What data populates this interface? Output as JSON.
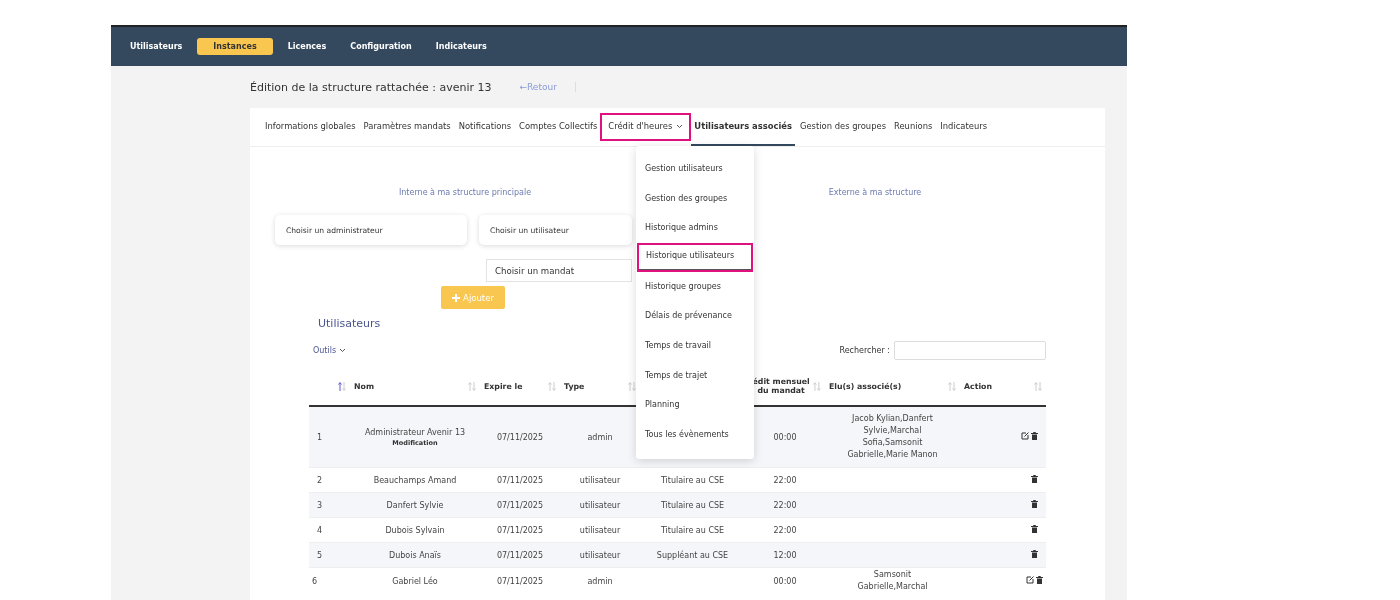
{
  "top_nav": [
    {
      "label": "Utilisateurs",
      "selected": false
    },
    {
      "label": "Instances",
      "selected": true
    },
    {
      "label": "Licences",
      "selected": false
    },
    {
      "label": "Configuration",
      "selected": false
    },
    {
      "label": "Indicateurs",
      "selected": false
    }
  ],
  "heading": "Édition de la structure rattachée : avenir 13",
  "back_link": "←Retour",
  "tabs": [
    {
      "label": "Informations globales",
      "selected": false,
      "highlighted": false
    },
    {
      "label": "Paramètres mandats",
      "selected": false,
      "highlighted": false
    },
    {
      "label": "Notifications",
      "selected": false,
      "highlighted": false
    },
    {
      "label": "Comptes Collectifs",
      "selected": false,
      "highlighted": false
    },
    {
      "label": "Crédit d'heures",
      "selected": false,
      "highlighted": true,
      "dropdown": true
    },
    {
      "label": "Utilisateurs associés",
      "selected": true,
      "highlighted": false
    },
    {
      "label": "Gestion des groupes",
      "selected": false,
      "highlighted": false
    },
    {
      "label": "Reunions",
      "selected": false,
      "highlighted": false
    },
    {
      "label": "Indicateurs",
      "selected": false,
      "highlighted": false
    }
  ],
  "dropdown_menu": [
    {
      "label": "Gestion utilisateurs",
      "highlighted": false
    },
    {
      "label": "Gestion des groupes",
      "highlighted": false
    },
    {
      "label": "Historique admins",
      "highlighted": false
    },
    {
      "label": "Historique utilisateurs",
      "highlighted": true
    },
    {
      "label": "Historique groupes",
      "highlighted": false
    },
    {
      "label": "Délais de prévenance",
      "highlighted": false
    },
    {
      "label": "Temps de travail",
      "highlighted": false
    },
    {
      "label": "Temps de trajet",
      "highlighted": false
    },
    {
      "label": "Planning",
      "highlighted": false
    },
    {
      "label": "Tous les évènements",
      "highlighted": false
    }
  ],
  "internal_label": "Interne à ma structure principale",
  "external_label": "Externe à ma structure",
  "admin_select": "Choisir un administrateur",
  "user_select": "Choisir un utilisateur",
  "mandate_select": "Choisir un mandat",
  "add_button": "Ajouter",
  "table_title": "Utilisateurs",
  "tools_menu": "Outils",
  "search": {
    "label": "Rechercher :"
  },
  "table": {
    "columns": [
      {
        "sorted": true
      },
      {
        "label": "Nom",
        "sorted": false
      },
      {
        "label": "Expire le",
        "sorted": false
      },
      {
        "label": "Type",
        "sorted": false
      },
      {
        "label": "édit mensuel du mandat",
        "sorted": false
      },
      {
        "label": "Elu(s) associé(s)",
        "sorted": false
      },
      {
        "label": "Action",
        "sorted": false
      }
    ],
    "rows": [
      {
        "index": "1",
        "name": "Administrateur Avenir 13",
        "note": "Modification",
        "expires": "07/11/2025",
        "type": "admin",
        "credit": "00:00",
        "elected": [
          "Jacob Kylian,Danfert",
          "Sylvie,Marchal",
          "Sofia,Samsonit",
          "Gabrielle,Marie Manon"
        ],
        "editable": true,
        "deletable": true
      },
      {
        "index": "2",
        "name": "Beauchamps Amand",
        "expires": "07/11/2025",
        "type": "utilisateur",
        "mandate": "Titulaire au CSE",
        "credit": "22:00",
        "editable": false,
        "deletable": true
      },
      {
        "index": "3",
        "name": "Danfert Sylvie",
        "expires": "07/11/2025",
        "type": "utilisateur",
        "mandate": "Titulaire au CSE",
        "credit": "22:00",
        "editable": false,
        "deletable": true
      },
      {
        "index": "4",
        "name": "Dubois Sylvain",
        "expires": "07/11/2025",
        "type": "utilisateur",
        "mandate": "Titulaire au CSE",
        "credit": "22:00",
        "editable": false,
        "deletable": true
      },
      {
        "index": "5",
        "name": "Dubois Anaïs",
        "expires": "07/11/2025",
        "type": "utilisateur",
        "mandate": "Suppléant au CSE",
        "credit": "12:00",
        "editable": false,
        "deletable": true
      },
      {
        "index": "6",
        "name": "Gabriel Léo",
        "expires": "07/11/2025",
        "type": "admin",
        "credit": "00:00",
        "elected": [
          "Samsonit",
          "Gabrielle,Marchal"
        ],
        "editable": true,
        "deletable": true
      }
    ]
  }
}
